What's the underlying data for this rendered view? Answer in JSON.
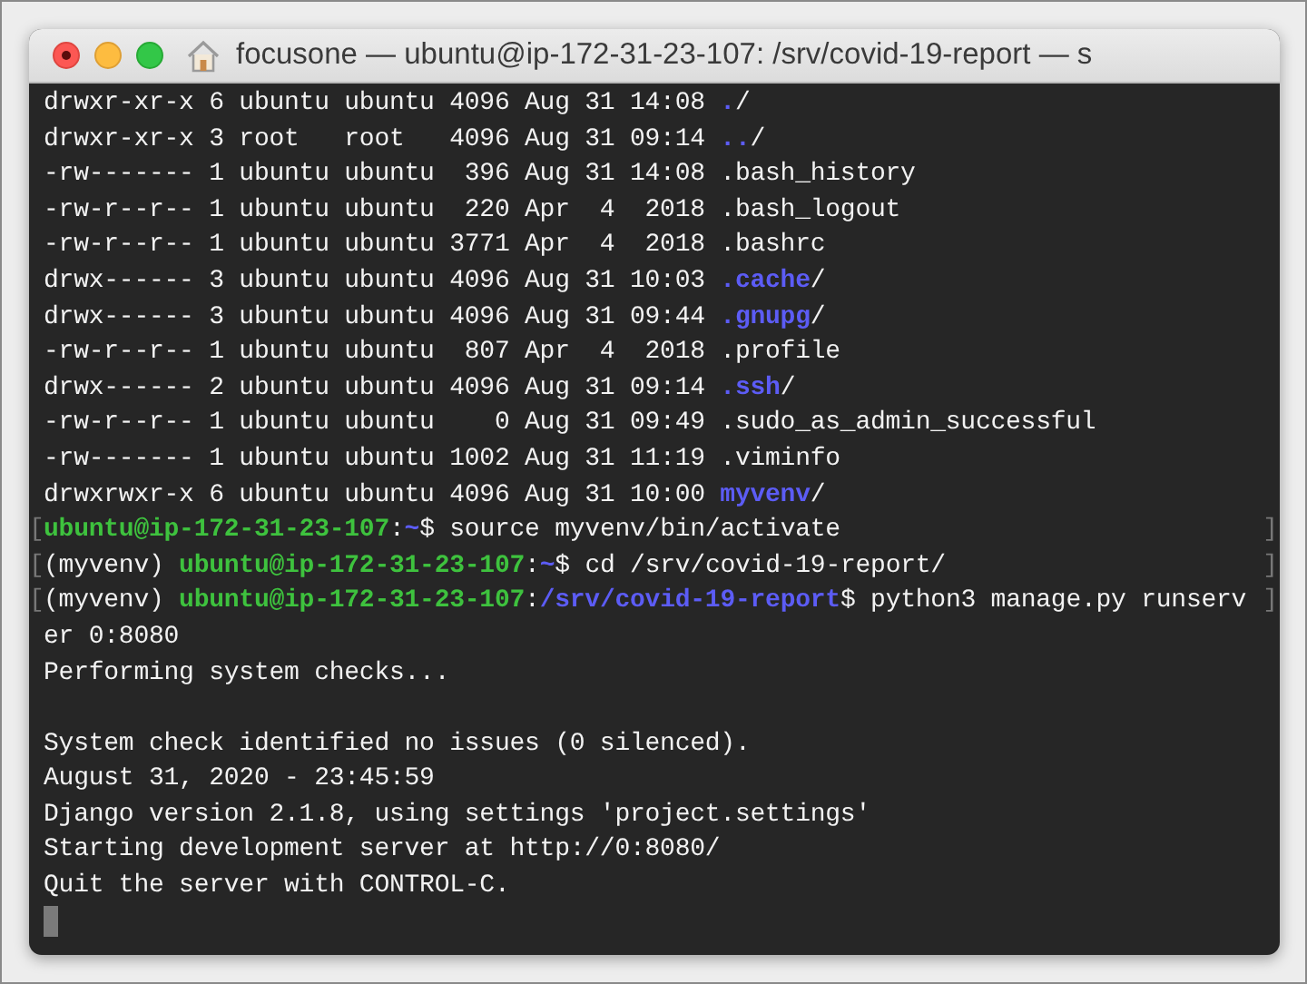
{
  "window": {
    "title": "focusone — ubuntu@ip-172-31-23-107: /srv/covid-19-report — s"
  },
  "terminal": {
    "lines": [
      {
        "segments": [
          {
            "kind": "plain",
            "text": "drwxr-xr-x 6 ubuntu ubuntu 4096 Aug 31 14:08 "
          },
          {
            "kind": "dir",
            "text": "."
          },
          {
            "kind": "plain",
            "text": "/"
          }
        ]
      },
      {
        "segments": [
          {
            "kind": "plain",
            "text": "drwxr-xr-x 3 root   root   4096 Aug 31 09:14 "
          },
          {
            "kind": "dir",
            "text": ".."
          },
          {
            "kind": "plain",
            "text": "/"
          }
        ]
      },
      {
        "segments": [
          {
            "kind": "plain",
            "text": "-rw------- 1 ubuntu ubuntu  396 Aug 31 14:08 .bash_history"
          }
        ]
      },
      {
        "segments": [
          {
            "kind": "plain",
            "text": "-rw-r--r-- 1 ubuntu ubuntu  220 Apr  4  2018 .bash_logout"
          }
        ]
      },
      {
        "segments": [
          {
            "kind": "plain",
            "text": "-rw-r--r-- 1 ubuntu ubuntu 3771 Apr  4  2018 .bashrc"
          }
        ]
      },
      {
        "segments": [
          {
            "kind": "plain",
            "text": "drwx------ 3 ubuntu ubuntu 4096 Aug 31 10:03 "
          },
          {
            "kind": "dir",
            "text": ".cache"
          },
          {
            "kind": "plain",
            "text": "/"
          }
        ]
      },
      {
        "segments": [
          {
            "kind": "plain",
            "text": "drwx------ 3 ubuntu ubuntu 4096 Aug 31 09:44 "
          },
          {
            "kind": "dir",
            "text": ".gnupg"
          },
          {
            "kind": "plain",
            "text": "/"
          }
        ]
      },
      {
        "segments": [
          {
            "kind": "plain",
            "text": "-rw-r--r-- 1 ubuntu ubuntu  807 Apr  4  2018 .profile"
          }
        ]
      },
      {
        "segments": [
          {
            "kind": "plain",
            "text": "drwx------ 2 ubuntu ubuntu 4096 Aug 31 09:14 "
          },
          {
            "kind": "dir",
            "text": ".ssh"
          },
          {
            "kind": "plain",
            "text": "/"
          }
        ]
      },
      {
        "segments": [
          {
            "kind": "plain",
            "text": "-rw-r--r-- 1 ubuntu ubuntu    0 Aug 31 09:49 .sudo_as_admin_successful"
          }
        ]
      },
      {
        "segments": [
          {
            "kind": "plain",
            "text": "-rw------- 1 ubuntu ubuntu 1002 Aug 31 11:19 .viminfo"
          }
        ]
      },
      {
        "segments": [
          {
            "kind": "plain",
            "text": "drwxrwxr-x 6 ubuntu ubuntu 4096 Aug 31 10:00 "
          },
          {
            "kind": "dir",
            "text": "myvenv"
          },
          {
            "kind": "plain",
            "text": "/"
          }
        ]
      },
      {
        "mark_open": "[",
        "mark_close": "]",
        "segments": [
          {
            "kind": "user",
            "text": "ubuntu@ip-172-31-23-107"
          },
          {
            "kind": "plain",
            "text": ":"
          },
          {
            "kind": "dir",
            "text": "~"
          },
          {
            "kind": "plain",
            "text": "$ source myvenv/bin/activate"
          }
        ]
      },
      {
        "mark_open": "[",
        "mark_close": "]",
        "segments": [
          {
            "kind": "plain",
            "text": "(myvenv) "
          },
          {
            "kind": "user",
            "text": "ubuntu@ip-172-31-23-107"
          },
          {
            "kind": "plain",
            "text": ":"
          },
          {
            "kind": "dir",
            "text": "~"
          },
          {
            "kind": "plain",
            "text": "$ cd /srv/covid-19-report/"
          }
        ]
      },
      {
        "mark_open": "[",
        "mark_close": "]",
        "segments": [
          {
            "kind": "plain",
            "text": "(myvenv) "
          },
          {
            "kind": "user",
            "text": "ubuntu@ip-172-31-23-107"
          },
          {
            "kind": "plain",
            "text": ":"
          },
          {
            "kind": "dir",
            "text": "/srv/covid-19-report"
          },
          {
            "kind": "plain",
            "text": "$ python3 manage.py runserv"
          }
        ]
      },
      {
        "segments": [
          {
            "kind": "plain",
            "text": "er 0:8080"
          }
        ]
      },
      {
        "segments": [
          {
            "kind": "plain",
            "text": "Performing system checks..."
          }
        ]
      },
      {
        "gap_before": true,
        "segments": [
          {
            "kind": "plain",
            "text": "System check identified no issues (0 silenced)."
          }
        ]
      },
      {
        "segments": [
          {
            "kind": "plain",
            "text": "August 31, 2020 - 23:45:59"
          }
        ]
      },
      {
        "segments": [
          {
            "kind": "plain",
            "text": "Django version 2.1.8, using settings 'project.settings'"
          }
        ]
      },
      {
        "segments": [
          {
            "kind": "plain",
            "text": "Starting development server at http://0:8080/"
          }
        ]
      },
      {
        "segments": [
          {
            "kind": "plain",
            "text": "Quit the server with CONTROL-C."
          }
        ]
      }
    ]
  }
}
